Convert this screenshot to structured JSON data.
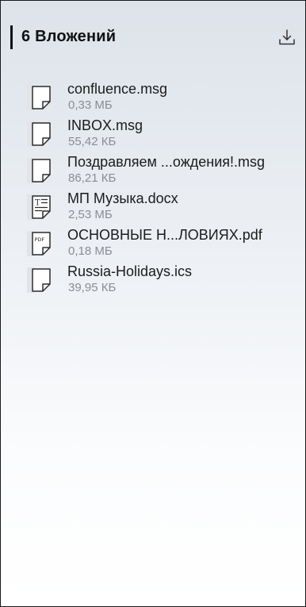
{
  "header": {
    "title": "6 Вложений",
    "download_icon": "download-icon"
  },
  "attachments": [
    {
      "name": "confluence.msg",
      "size": "0,33 МБ",
      "icon": "generic-file-icon"
    },
    {
      "name": "INBOX.msg",
      "size": "55,42 КБ",
      "icon": "generic-file-icon"
    },
    {
      "name": "Поздравляем ...ождения!.msg",
      "size": "86,21 КБ",
      "icon": "generic-file-icon"
    },
    {
      "name": "МП Музыка.docx",
      "size": "2,53 МБ",
      "icon": "text-document-icon",
      "icon_text": "T"
    },
    {
      "name": "ОСНОВНЫЕ Н...ЛОВИЯХ.pdf",
      "size": "0,18 МБ",
      "icon": "pdf-file-icon",
      "icon_text": "PDF"
    },
    {
      "name": "Russia-Holidays.ics",
      "size": "39,95 КБ",
      "icon": "generic-file-icon"
    }
  ],
  "colors": {
    "text": "#1b1b1b",
    "secondary_text": "#8a8e94",
    "icon_stroke": "#2b2b2b",
    "icon_fill": "#e2e4e7"
  }
}
